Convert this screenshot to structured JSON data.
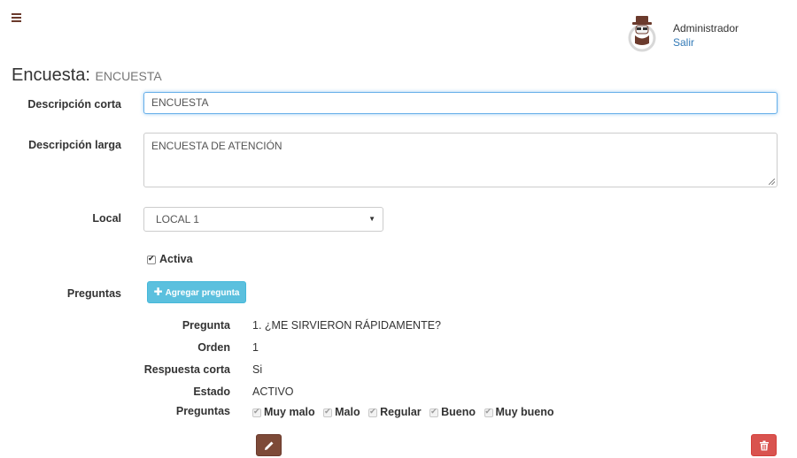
{
  "header": {
    "user_name": "Administrador",
    "logout_label": "Salir"
  },
  "page": {
    "title": "Encuesta:",
    "subtitle": "ENCUESTA"
  },
  "form": {
    "short_desc_label": "Descripción corta",
    "short_desc_value": "ENCUESTA",
    "long_desc_label": "Descripción larga",
    "long_desc_value": "ENCUESTA DE ATENCIÓN",
    "local_label": "Local",
    "local_value": "LOCAL 1",
    "active_label": "Activa",
    "active_checked": true,
    "questions_label": "Preguntas",
    "add_question_label": "Agregar pregunta"
  },
  "question": {
    "labels": {
      "pregunta": "Pregunta",
      "orden": "Orden",
      "respuesta_corta": "Respuesta corta",
      "estado": "Estado",
      "preguntas": "Preguntas"
    },
    "pregunta": "1. ¿ME SIRVIERON RÁPIDAMENTE?",
    "orden": "1",
    "respuesta_corta": "Si",
    "estado": "ACTIVO",
    "options": [
      "Muy malo",
      "Malo",
      "Regular",
      "Bueno",
      "Muy bueno"
    ]
  },
  "icons": {
    "menu": "hamburger-icon",
    "avatar": "spy-avatar-icon",
    "add": "plus-icon",
    "edit": "pencil-icon",
    "delete": "trash-icon"
  },
  "colors": {
    "brand": "#6b3a2c",
    "info": "#5bc0de",
    "danger": "#d9534f",
    "link": "#337ab7"
  }
}
